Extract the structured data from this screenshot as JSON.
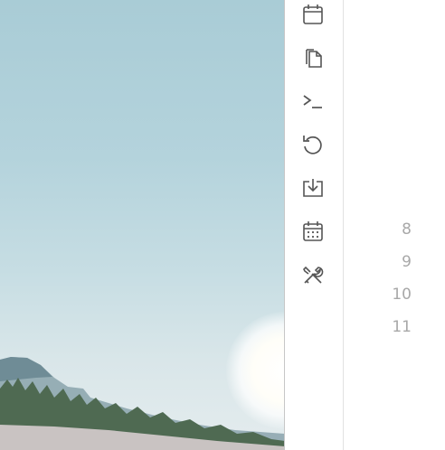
{
  "wallpaper": {
    "description_icon": "desert-sunrise-wallpaper"
  },
  "toolbar": {
    "tools": [
      {
        "icon": "calendar-icon"
      },
      {
        "icon": "copy-icon"
      },
      {
        "icon": "terminal-icon"
      },
      {
        "icon": "undo-icon"
      },
      {
        "icon": "download-icon"
      },
      {
        "icon": "calendar-grid-icon"
      },
      {
        "icon": "tools-icon"
      }
    ]
  },
  "editor": {
    "line_numbers": [
      "8",
      "9",
      "10",
      "11"
    ]
  },
  "colors": {
    "icon": "#555555",
    "line_number": "#a8a8a8",
    "divider": "#c7c7c7"
  }
}
